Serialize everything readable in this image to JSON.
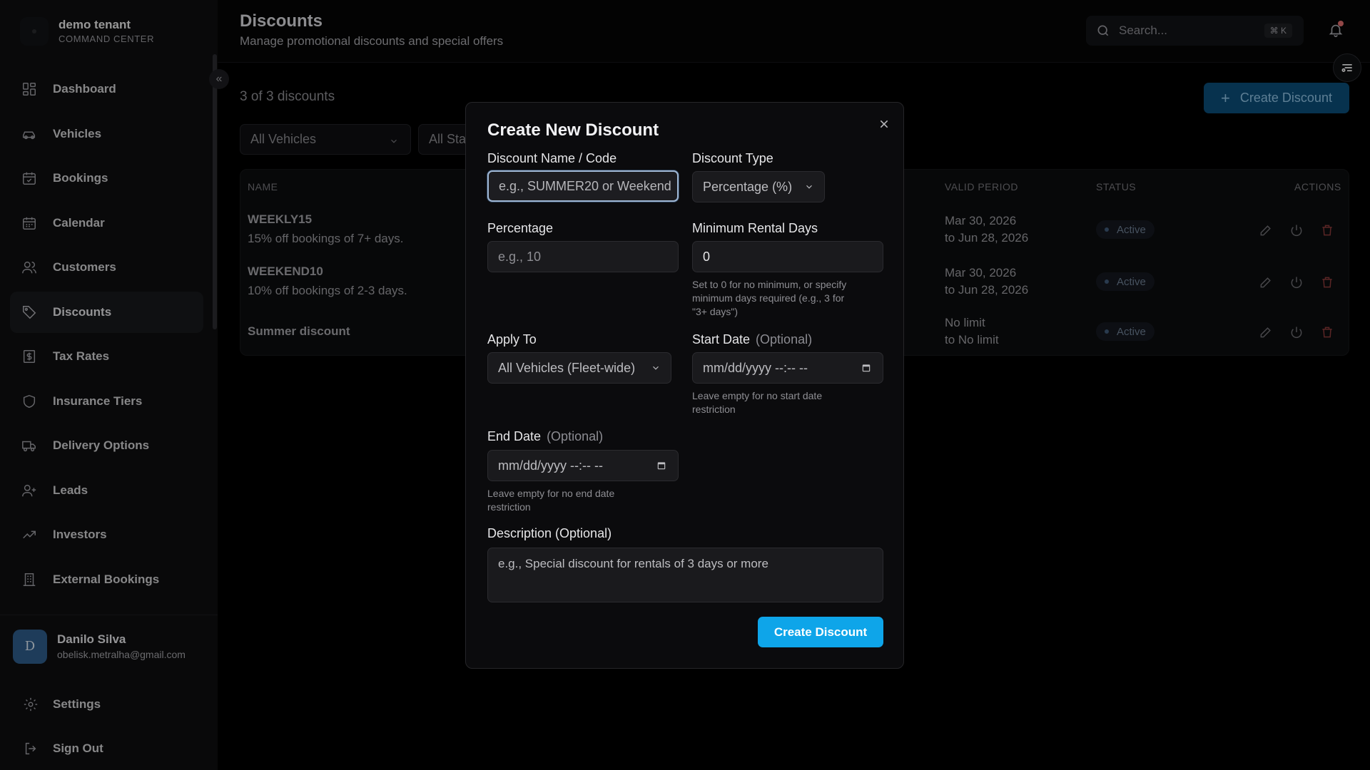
{
  "brand": {
    "name": "demo tenant",
    "subtitle": "COMMAND CENTER"
  },
  "sidebar": {
    "items": [
      {
        "label": "Dashboard",
        "icon": "dashboard-icon"
      },
      {
        "label": "Vehicles",
        "icon": "car-icon"
      },
      {
        "label": "Bookings",
        "icon": "calendar-check-icon"
      },
      {
        "label": "Calendar",
        "icon": "calendar-icon"
      },
      {
        "label": "Customers",
        "icon": "users-icon"
      },
      {
        "label": "Discounts",
        "icon": "tag-icon",
        "active": true
      },
      {
        "label": "Tax Rates",
        "icon": "receipt-icon"
      },
      {
        "label": "Insurance Tiers",
        "icon": "shield-icon"
      },
      {
        "label": "Delivery Options",
        "icon": "truck-icon"
      },
      {
        "label": "Leads",
        "icon": "user-plus-icon"
      },
      {
        "label": "Investors",
        "icon": "trending-up-icon"
      },
      {
        "label": "External Bookings",
        "icon": "building-icon"
      }
    ],
    "user": {
      "initial": "D",
      "name": "Danilo Silva",
      "email": "obelisk.metralha@gmail.com"
    },
    "settings_label": "Settings",
    "signout_label": "Sign Out"
  },
  "header": {
    "title": "Discounts",
    "subtitle": "Manage promotional discounts and special offers",
    "search_placeholder": "Search...",
    "search_shortcut": "⌘ K"
  },
  "main": {
    "count_text": "3 of 3 discounts",
    "create_button": "Create Discount",
    "filters": {
      "vehicles": "All Vehicles",
      "status": "All Sta"
    },
    "table": {
      "headers": {
        "name": "NAME",
        "valid_period": "VALID PERIOD",
        "status": "STATUS",
        "actions": "ACTIONS"
      },
      "rows": [
        {
          "name": "WEEKLY15",
          "description": "15% off bookings of 7+ days.",
          "period_from": "Mar 30, 2026",
          "period_to": "to Jun 28, 2026",
          "status": "Active"
        },
        {
          "name": "WEEKEND10",
          "description": "10% off bookings of 2-3 days.",
          "period_from": "Mar 30, 2026",
          "period_to": "to Jun 28, 2026",
          "status": "Active"
        },
        {
          "name": "Summer discount",
          "description": "",
          "period_from": "No limit",
          "period_to": "to No limit",
          "status": "Active"
        }
      ]
    }
  },
  "modal": {
    "title": "Create New Discount",
    "name_label": "Discount Name / Code",
    "name_placeholder": "e.g., SUMMER20 or Weekend",
    "type_label": "Discount Type",
    "type_value": "Percentage (%)",
    "percentage_label": "Percentage",
    "percentage_placeholder": "e.g., 10",
    "min_days_label": "Minimum Rental Days",
    "min_days_value": "0",
    "min_days_help_1": "Set to 0 for no minimum, or specify",
    "min_days_help_2": "minimum days required (e.g., 3 for",
    "min_days_help_3": "\"3+ days\")",
    "apply_label": "Apply To",
    "apply_value": "All Vehicles (Fleet-wide)",
    "start_label": "Start Date",
    "optional_text": "(Optional)",
    "start_placeholder": "mm/dd/yyyy --:-- --",
    "start_help_1": "Leave empty for no start date",
    "start_help_2": "restriction",
    "end_label": "End Date",
    "end_placeholder": "mm/dd/yyyy --:-- --",
    "end_help_1": "Leave empty for no end date",
    "end_help_2": "restriction",
    "description_label": "Description (Optional)",
    "description_placeholder": "e.g., Special discount for rentals of 3 days or more",
    "submit_label": "Create Discount"
  },
  "colors": {
    "accent": "#0ea5e9",
    "danger": "#e05555",
    "background": "#000000"
  }
}
